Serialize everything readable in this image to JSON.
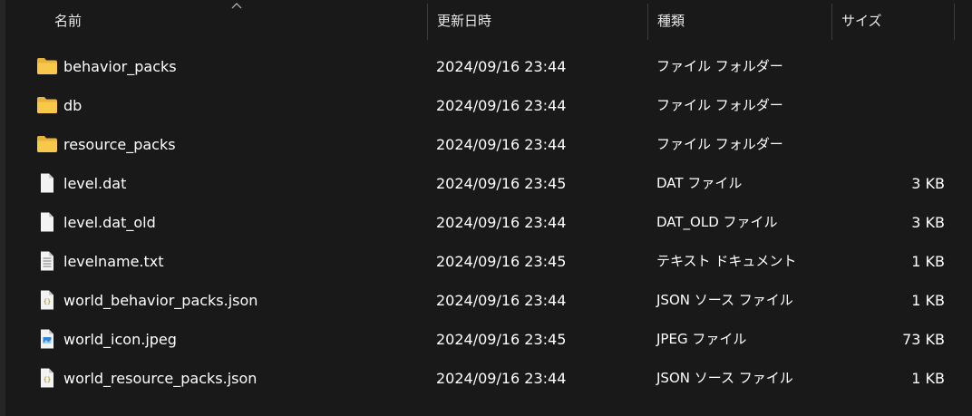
{
  "columns": {
    "name": "名前",
    "date": "更新日時",
    "type": "種類",
    "size": "サイズ"
  },
  "files": [
    {
      "name": "behavior_packs",
      "date": "2024/09/16 23:44",
      "type": "ファイル フォルダー",
      "size": "",
      "icon": "folder-icon"
    },
    {
      "name": "db",
      "date": "2024/09/16 23:44",
      "type": "ファイル フォルダー",
      "size": "",
      "icon": "folder-icon"
    },
    {
      "name": "resource_packs",
      "date": "2024/09/16 23:44",
      "type": "ファイル フォルダー",
      "size": "",
      "icon": "folder-icon"
    },
    {
      "name": "level.dat",
      "date": "2024/09/16 23:45",
      "type": "DAT ファイル",
      "size": "3 KB",
      "icon": "file-icon"
    },
    {
      "name": "level.dat_old",
      "date": "2024/09/16 23:44",
      "type": "DAT_OLD ファイル",
      "size": "3 KB",
      "icon": "file-icon"
    },
    {
      "name": "levelname.txt",
      "date": "2024/09/16 23:45",
      "type": "テキスト ドキュメント",
      "size": "1 KB",
      "icon": "text-file-icon"
    },
    {
      "name": "world_behavior_packs.json",
      "date": "2024/09/16 23:44",
      "type": "JSON ソース ファイル",
      "size": "1 KB",
      "icon": "json-file-icon"
    },
    {
      "name": "world_icon.jpeg",
      "date": "2024/09/16 23:45",
      "type": "JPEG ファイル",
      "size": "73 KB",
      "icon": "image-file-icon"
    },
    {
      "name": "world_resource_packs.json",
      "date": "2024/09/16 23:44",
      "type": "JSON ソース ファイル",
      "size": "1 KB",
      "icon": "json-file-icon"
    }
  ],
  "colors": {
    "background": "#191919",
    "text": "#ffffff",
    "folder": "#f8c84a",
    "divider": "#3c3c3c"
  }
}
